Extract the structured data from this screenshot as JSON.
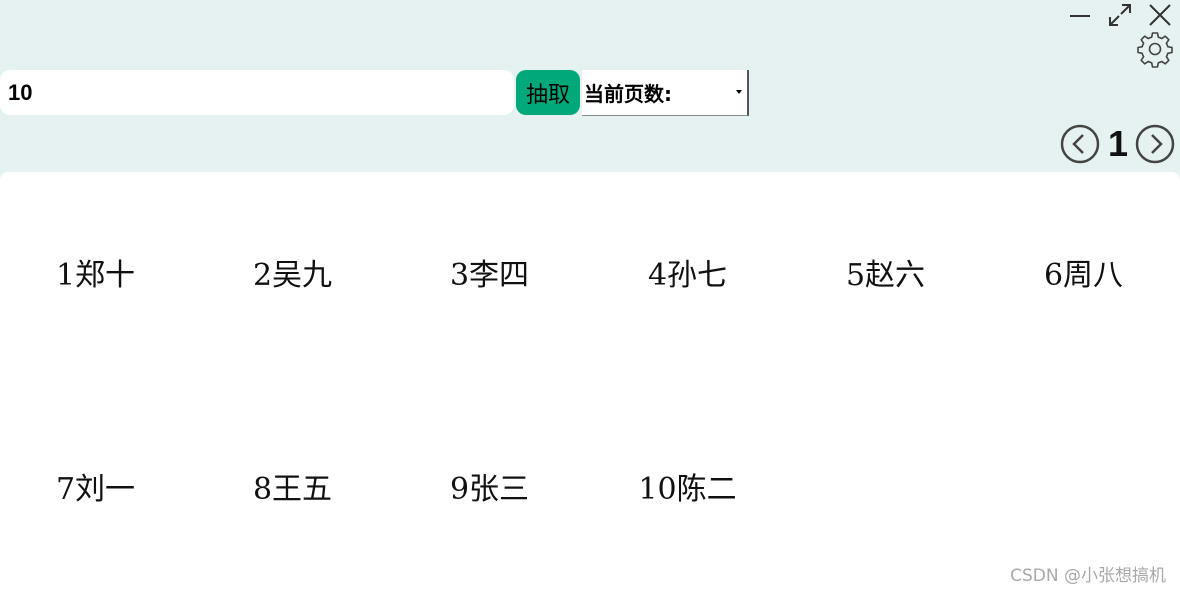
{
  "window_controls": {
    "minimize_icon": "minimize-icon",
    "maximize_icon": "maximize-icon",
    "close_icon": "close-icon",
    "settings_icon": "gear-icon"
  },
  "toolbar": {
    "count_value": "10",
    "draw_label": "抽取",
    "page_select_label": "当前页数:"
  },
  "pager": {
    "prev_icon": "chevron-left-icon",
    "current_page": "1",
    "next_icon": "chevron-right-icon"
  },
  "results": {
    "items": [
      "1郑十",
      "2吴九",
      "3李四",
      "4孙七",
      "5赵六",
      "6周八",
      "7刘一",
      "8王五",
      "9张三",
      "10陈二"
    ]
  },
  "watermark": "CSDN @小张想搞机",
  "colors": {
    "background": "#e6f2f2",
    "accent": "#00a87a",
    "panel": "#ffffff"
  }
}
